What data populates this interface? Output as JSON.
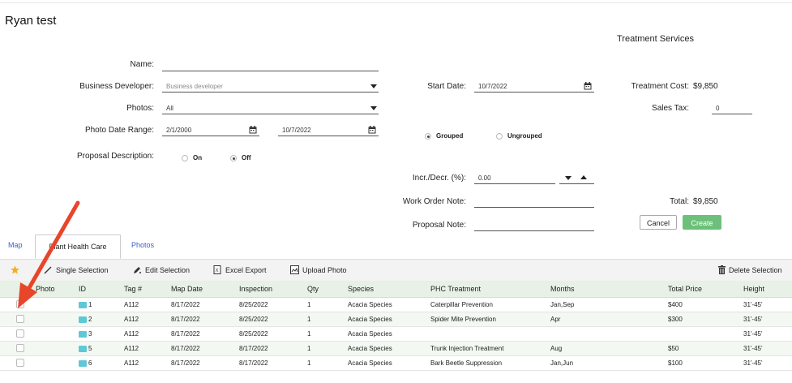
{
  "page_title": "Ryan test",
  "section_title": "Treatment Services",
  "form": {
    "name_label": "Name:",
    "name_value": "",
    "business_developer_label": "Business Developer:",
    "business_developer_placeholder": "Business developer",
    "photos_label": "Photos:",
    "photos_value": "All",
    "photo_date_range_label": "Photo Date Range:",
    "photo_date_from": "2/1/2000",
    "photo_date_to": "10/7/2022",
    "proposal_description_label": "Proposal Description:",
    "proposal_description_on": "On",
    "proposal_description_off": "Off",
    "start_date_label": "Start Date:",
    "start_date_value": "10/7/2022",
    "grouped_label": "Grouped",
    "ungrouped_label": "Ungrouped",
    "incr_decr_label": "Incr./Decr. (%):",
    "incr_decr_value": "0.00",
    "work_order_note_label": "Work Order Note:",
    "proposal_note_label": "Proposal Note:",
    "treatment_cost_label": "Treatment Cost:",
    "treatment_cost_value": "$9,850",
    "sales_tax_label": "Sales Tax:",
    "sales_tax_value": "0",
    "total_label": "Total:",
    "total_value": "$9,850",
    "cancel_label": "Cancel",
    "create_label": "Create"
  },
  "tabs": [
    "Map",
    "Plant Health Care",
    "Photos"
  ],
  "toolbar": {
    "single_selection": "Single Selection",
    "edit_selection": "Edit Selection",
    "excel_export": "Excel Export",
    "upload_photo": "Upload Photo",
    "delete_selection": "Delete Selection"
  },
  "table": {
    "columns": [
      "Photo",
      "ID",
      "Tag #",
      "Map Date",
      "Inspection",
      "Qty",
      "Species",
      "PHC Treatment",
      "Months",
      "Total Price",
      "Height"
    ],
    "rows": [
      [
        "1",
        "A112",
        "8/17/2022",
        "8/25/2022",
        "1",
        "Acacia Species",
        "Caterpillar Prevention",
        "Jan,Sep",
        "$400",
        "31'-45'"
      ],
      [
        "2",
        "A112",
        "8/17/2022",
        "8/25/2022",
        "1",
        "Acacia Species",
        "Spider Mite Prevention",
        "Apr",
        "$300",
        "31'-45'"
      ],
      [
        "3",
        "A112",
        "8/17/2022",
        "8/25/2022",
        "1",
        "Acacia Species",
        "",
        "",
        "",
        "31'-45'"
      ],
      [
        "5",
        "A112",
        "8/17/2022",
        "8/17/2022",
        "1",
        "Acacia Species",
        "Trunk Injection Treatment",
        "Aug",
        "$50",
        "31'-45'"
      ],
      [
        "6",
        "A112",
        "8/17/2022",
        "8/17/2022",
        "1",
        "Acacia Species",
        "Bark Beetle Suppression",
        "Jan,Jun",
        "$100",
        "31'-45'"
      ]
    ]
  },
  "colors": {
    "create_button": "#6cc07a",
    "tab_link": "#3b5ecc",
    "annotation_arrow": "#e8452a",
    "id_swatch": "#5fc8d6",
    "header_bg": "#e7f1e6"
  },
  "icons": [
    "calendar-icon",
    "star-icon",
    "pencil-icon",
    "edit-icon",
    "excel-icon",
    "upload-photo-icon",
    "trash-icon",
    "red-arrow-annotation"
  ]
}
